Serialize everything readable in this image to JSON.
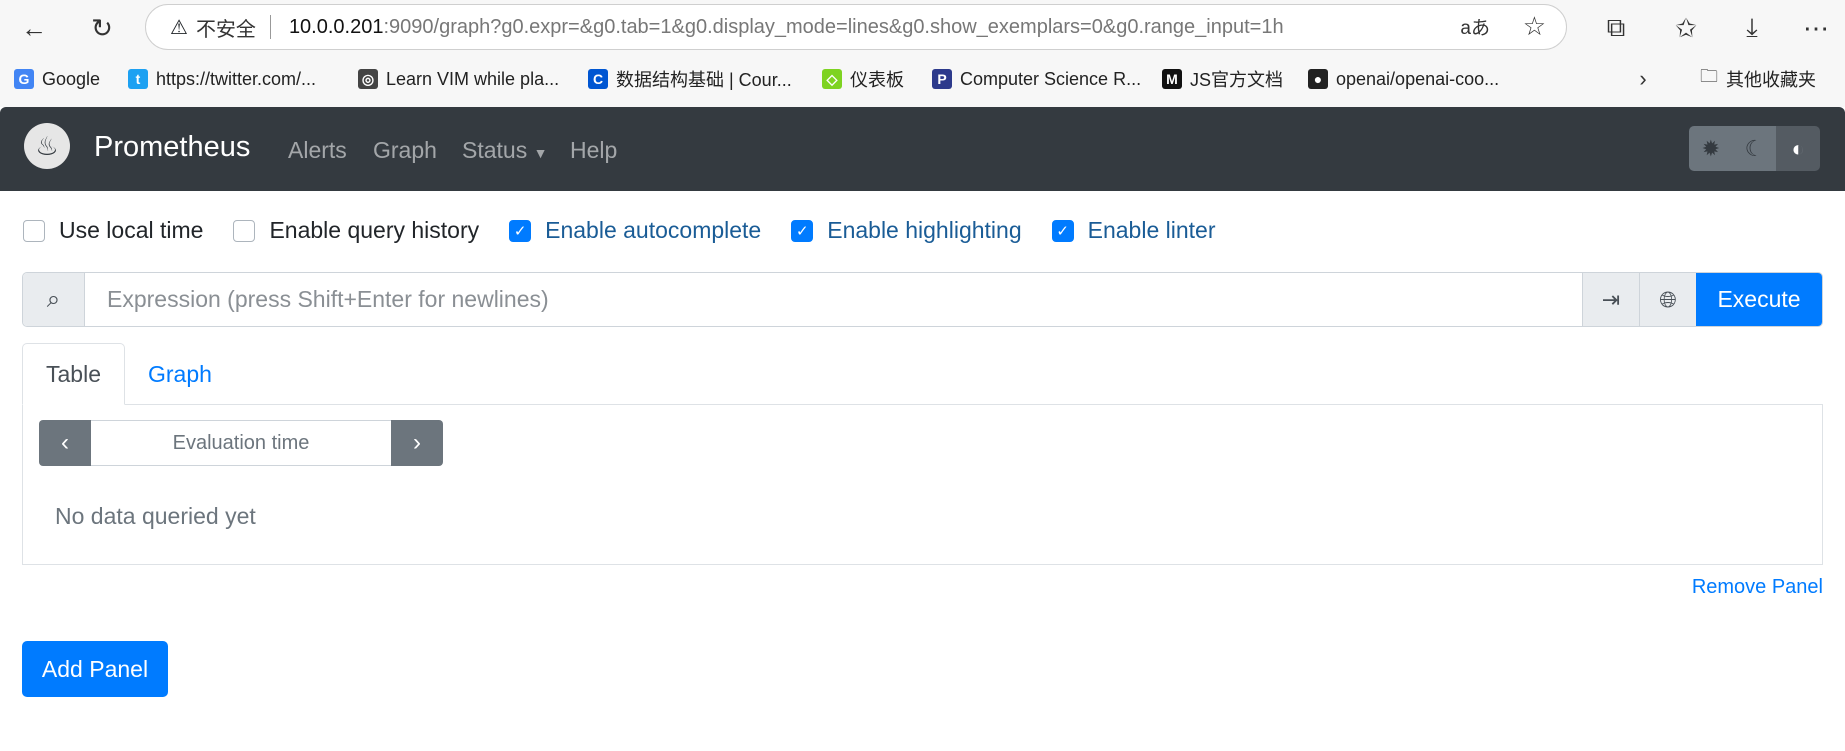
{
  "browser": {
    "address": {
      "insecure_label": "不安全",
      "host": "10.0.0.201",
      "path": ":9090/graph?g0.expr=&g0.tab=1&g0.display_mode=lines&g0.show_exemplars=0&g0.range_input=1h"
    },
    "bookmarks": [
      {
        "label": "Google",
        "icon": "google-icon",
        "color": "#4285f4",
        "glyph": "G"
      },
      {
        "label": "https://twitter.com/...",
        "icon": "twitter-icon",
        "color": "#1da1f2",
        "glyph": "t"
      },
      {
        "label": "Learn VIM while pla...",
        "icon": "globe-icon",
        "color": "#444444",
        "glyph": "◎"
      },
      {
        "label": "数据结构基础 | Cour...",
        "icon": "coursera-icon",
        "color": "#0056d2",
        "glyph": "C"
      },
      {
        "label": "仪表板",
        "icon": "cube-icon",
        "color": "#7ed321",
        "glyph": "◇"
      },
      {
        "label": "Computer Science R...",
        "icon": "p-icon",
        "color": "#2d3a8c",
        "glyph": "P"
      },
      {
        "label": "JS官方文档",
        "icon": "m-icon",
        "color": "#111111",
        "glyph": "M"
      },
      {
        "label": "openai/openai-coo...",
        "icon": "github-icon",
        "color": "#222222",
        "glyph": "●"
      }
    ],
    "other_bookmarks": "其他收藏夹"
  },
  "navbar": {
    "brand": "Prometheus",
    "links": [
      "Alerts",
      "Graph",
      "Status",
      "Help"
    ]
  },
  "options": [
    {
      "label": "Use local time",
      "checked": false
    },
    {
      "label": "Enable query history",
      "checked": false
    },
    {
      "label": "Enable autocomplete",
      "checked": true
    },
    {
      "label": "Enable highlighting",
      "checked": true
    },
    {
      "label": "Enable linter",
      "checked": true
    }
  ],
  "query": {
    "placeholder": "Expression (press Shift+Enter for newlines)",
    "value": "",
    "execute": "Execute"
  },
  "tabs": [
    "Table",
    "Graph"
  ],
  "panel": {
    "evaluation_placeholder": "Evaluation time",
    "no_data": "No data queried yet",
    "remove": "Remove Panel"
  },
  "add_panel": "Add Panel",
  "colors": {
    "primary": "#007bff",
    "navbar": "#343a40"
  }
}
